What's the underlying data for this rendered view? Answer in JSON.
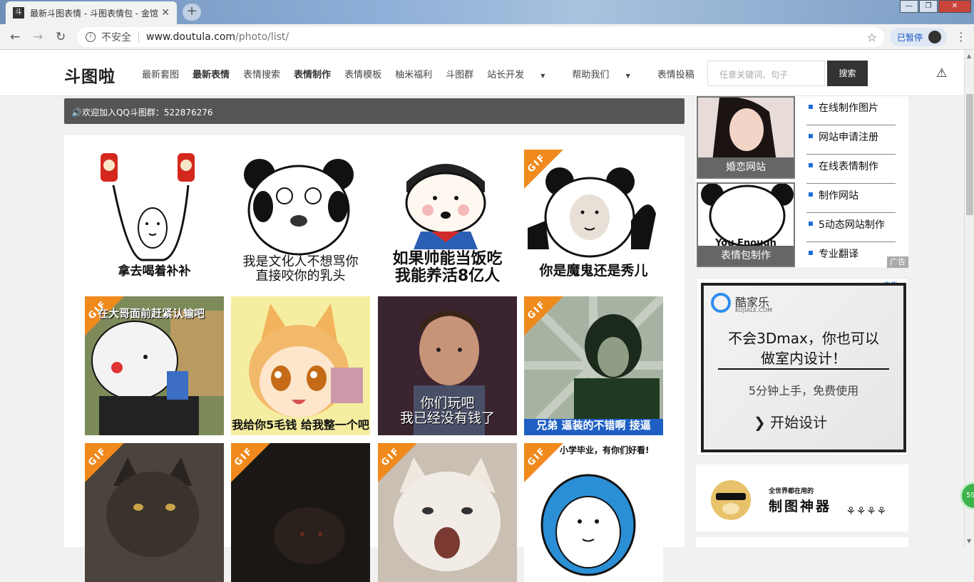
{
  "browser": {
    "tab_title": "最新斗图表情 - 斗图表情包 - 金馆",
    "tab_close": "✕",
    "new_tab": "+",
    "insecure_label": "不安全",
    "url_host": "www.doutula.com",
    "url_path": "/photo/list/",
    "profile_label": "已暂停",
    "window_buttons": [
      "—",
      "❐",
      "✕"
    ]
  },
  "site": {
    "logo": "斗图啦",
    "nav": [
      {
        "label": "最新套图",
        "bold": false
      },
      {
        "label": "最新表情",
        "bold": true
      },
      {
        "label": "表情搜索",
        "bold": false
      },
      {
        "label": "表情制作",
        "bold": true
      },
      {
        "label": "表情模板",
        "bold": false
      },
      {
        "label": "柚米福利",
        "bold": false
      },
      {
        "label": "斗图群",
        "bold": false
      },
      {
        "label": "站长开发",
        "bold": false,
        "caret": true
      },
      {
        "label": "帮助我们",
        "bold": false,
        "caret": true
      },
      {
        "label": "表情投稿",
        "bold": false
      }
    ],
    "search_placeholder": "任意关键词、句子",
    "search_button": "搜索",
    "notice": "🔊欢迎加入QQ斗图群：522876276"
  },
  "grid": {
    "gif_label": "GIF",
    "items": [
      {
        "caption": "拿去喝着补补",
        "gif": false
      },
      {
        "caption": "我是文化人不想骂你\n直接咬你的乳头",
        "gif": false
      },
      {
        "caption": "如果帅能当饭吃\n我能养活8亿人",
        "gif": false
      },
      {
        "caption": "你是魔鬼还是秀儿",
        "gif": true
      },
      {
        "caption": "在大哥面前赶紧认输吧",
        "gif": true
      },
      {
        "caption": "我给你5毛钱 给我整一个吧",
        "gif": false
      },
      {
        "caption": "你们玩吧\n我已经没有钱了",
        "gif": false
      },
      {
        "caption": "兄弟 逼装的不错啊 接逼",
        "gif": true
      },
      {
        "caption": "",
        "gif": true
      },
      {
        "caption": "",
        "gif": true
      },
      {
        "caption": "",
        "gif": true
      },
      {
        "caption": "小学毕业，有你们好看!",
        "gif": true
      }
    ]
  },
  "sidebar": {
    "thumb1_label": "婚恋网站",
    "thumb2_label": "表情包制作",
    "thumb2_text": "You Enough",
    "links": [
      "在线制作图片",
      "网站申请注册",
      "在线表情制作",
      "制作网站",
      "5动态网站制作",
      "专业翻译"
    ],
    "ad_tag": "广告",
    "ad2": {
      "brand": "酷家乐",
      "brand_sub": "KUJIALE.COM",
      "headline_1": "不会3Dmax，你也可以",
      "headline_2": "做室内设计！",
      "sub": "5分钟上手，免费使用",
      "cta": "开始设计",
      "corner": "广告✕"
    },
    "ad3": {
      "line1": "全世界都在用的",
      "line2": "制图神器"
    }
  },
  "badge": "59"
}
